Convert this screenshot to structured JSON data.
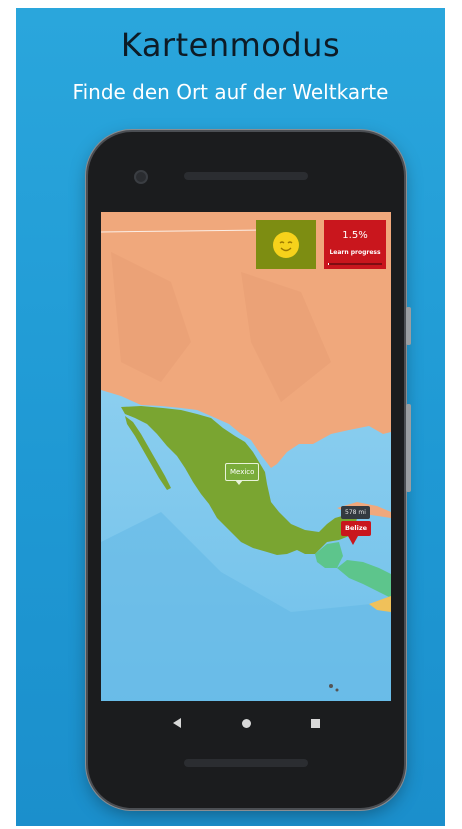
{
  "headline": "Kartenmodus",
  "subline": "Finde den Ort auf der Weltkarte",
  "game": {
    "progress_value": "1.5%",
    "progress_label": "Learn progress",
    "progress_fraction": 0.015,
    "mood_icon": "smiley-face-icon",
    "country_label": "Mexico",
    "distance_label": "578 mi",
    "target_label": "Belize"
  },
  "nav": {
    "back_icon": "back-triangle-icon",
    "home_icon": "home-circle-icon",
    "recent_icon": "recent-apps-square-icon"
  },
  "colors": {
    "background": "#1f99d4",
    "usa": "#f0a87c",
    "mexico": "#7aa531",
    "ocean": "#8fd0f0",
    "badge_green": "#7d8d12",
    "badge_red": "#c9161d"
  }
}
